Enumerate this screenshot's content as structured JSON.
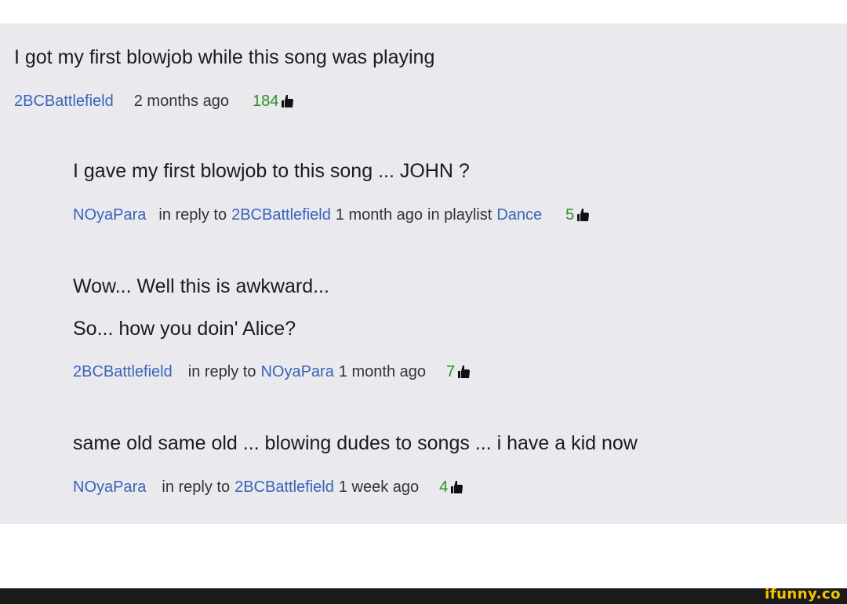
{
  "comments": [
    {
      "text": "I got my first blowjob while this song was playing",
      "user": "2BCBattlefield",
      "time": "2 months ago",
      "likes": "184"
    },
    {
      "text": "I gave my first blowjob to this song ... JOHN ?",
      "user": "NOyaPara",
      "reply_prefix": "in reply to",
      "reply_to": "2BCBattlefield",
      "time": "1 month ago",
      "playlist_prefix": "in playlist",
      "playlist": "Dance",
      "likes": "5"
    },
    {
      "text_lines": [
        "Wow... Well this is awkward...",
        "So... how you doin' Alice?"
      ],
      "user": "2BCBattlefield",
      "reply_prefix": "in reply to",
      "reply_to": "NOyaPara",
      "time": "1 month ago",
      "likes": "7"
    },
    {
      "text": "same old same old ... blowing dudes to songs ... i have a kid now",
      "user": "NOyaPara",
      "reply_prefix": "in reply to",
      "reply_to": "2BCBattlefield",
      "time": "1 week ago",
      "likes": "4"
    }
  ],
  "icons": {
    "like": "thumbs-up-icon"
  },
  "colors": {
    "username": "#3a64b8",
    "likes": "#2f8f24",
    "panel": "#e9e9ee",
    "brand": "#f6c700"
  },
  "watermark": "ifunny.co"
}
